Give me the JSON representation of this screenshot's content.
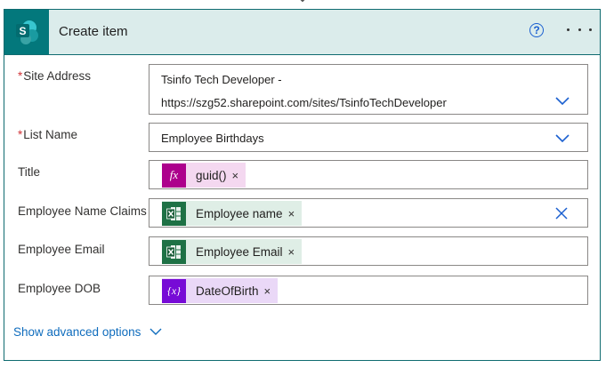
{
  "header": {
    "title": "Create item",
    "help_glyph": "?",
    "app_letter": "S",
    "icon": "sharepoint-icon"
  },
  "fields": {
    "site_address": {
      "label": "Site Address",
      "required": "*",
      "value_line1": "Tsinfo Tech Developer -",
      "value_line2": "https://szg52.sharepoint.com/sites/TsinfoTechDeveloper"
    },
    "list_name": {
      "label": "List Name",
      "required": "*",
      "value": "Employee Birthdays"
    },
    "title": {
      "label": "Title",
      "token": "guid()",
      "token_type": "expression",
      "token_icon_glyph": "fx"
    },
    "employee_name_claims": {
      "label": "Employee Name Claims",
      "token": "Employee name",
      "token_type": "excel"
    },
    "employee_email": {
      "label": "Employee Email",
      "token": "Employee Email",
      "token_type": "excel"
    },
    "employee_dob": {
      "label": "Employee DOB",
      "token": "DateOfBirth",
      "token_type": "variable",
      "token_icon_glyph": "{x}"
    }
  },
  "token_remove_glyph": "×",
  "advanced_label": "Show advanced options",
  "colors": {
    "accent": "#03787c",
    "header_bg": "#dbeceb",
    "link": "#0f6cbd",
    "required": "#d13438",
    "expression": "#ad008c",
    "excel": "#1e7145",
    "variable": "#770bd6"
  }
}
